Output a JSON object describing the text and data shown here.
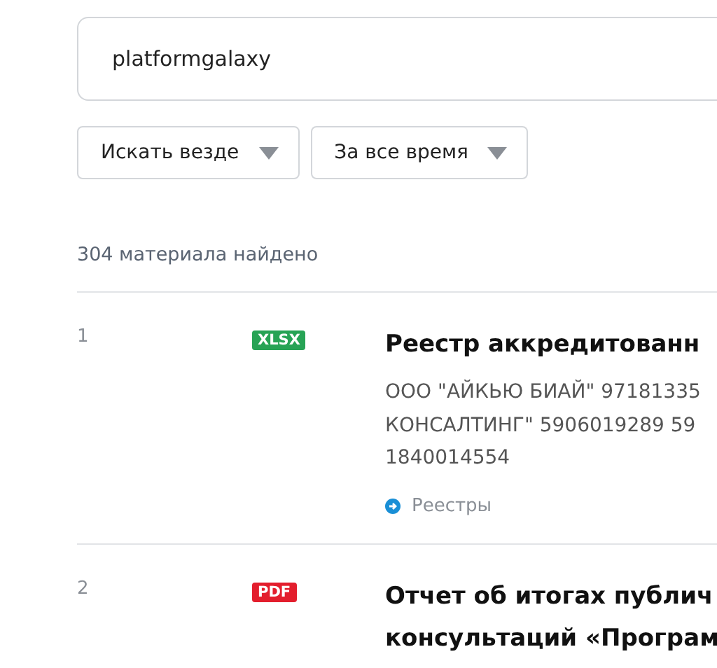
{
  "search": {
    "value": "platformgalaxy"
  },
  "filters": [
    {
      "label": "Искать везде"
    },
    {
      "label": "За все время"
    }
  ],
  "result_count": "304 материала найдено",
  "results": [
    {
      "number": "1",
      "format": "XLSX",
      "color": "#27a355",
      "title_lines": [
        "Реестр аккредитованн"
      ],
      "snippet_lines": [
        "ООО \"АЙКЬЮ БИАЙ\" 97181335",
        "КОНСАЛТИНГ\" 5906019289 59",
        "1840014554"
      ],
      "category": "Реестры"
    },
    {
      "number": "2",
      "format": "PDF",
      "color": "#e31e2d",
      "title_lines": [
        "Отчет об итогах публич",
        "консультаций «Програм"
      ]
    }
  ]
}
